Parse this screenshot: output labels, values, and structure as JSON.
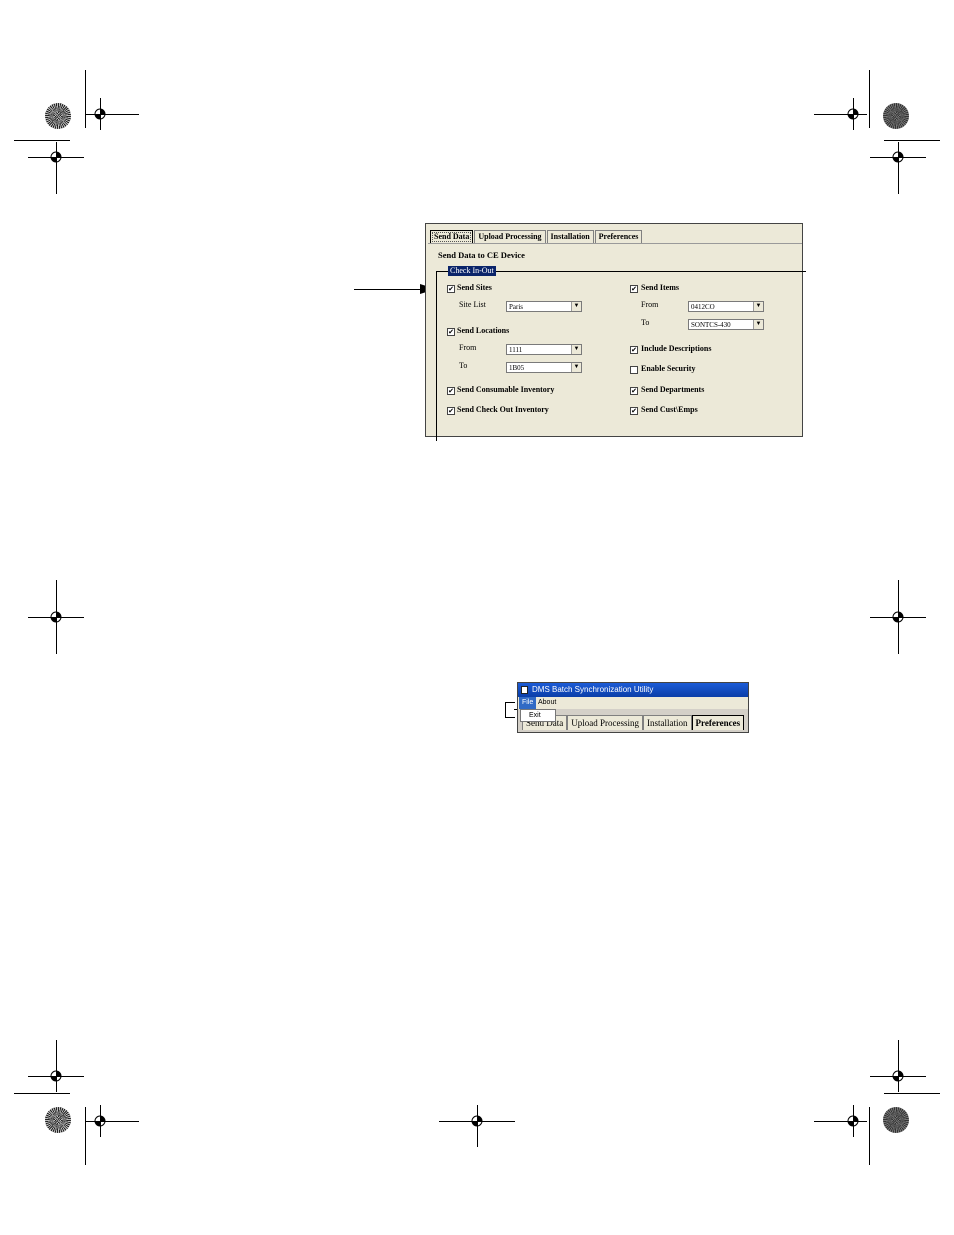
{
  "dialog": {
    "tabs": [
      "Send Data",
      "Upload Processing",
      "Installation",
      "Preferences"
    ],
    "active_tab": "Send Data",
    "panel_title": "Send Data to CE Device",
    "group_label": "Check In-Out",
    "options": {
      "send_sites": {
        "label": "Send Sites",
        "checked": true
      },
      "site_list_label": "Site List",
      "site_list_value": "Paris",
      "send_locations": {
        "label": "Send Locations",
        "checked": true
      },
      "loc_from_label": "From",
      "loc_from_value": "1111",
      "loc_to_label": "To",
      "loc_to_value": "1B05",
      "send_consumable": {
        "label": "Send Consumable Inventory",
        "checked": true
      },
      "send_checkout": {
        "label": "Send Check Out Inventory",
        "checked": true
      },
      "send_items": {
        "label": "Send Items",
        "checked": true
      },
      "items_from_label": "From",
      "items_from_value": "0412CO",
      "items_to_label": "To",
      "items_to_value": "SONTCS-430",
      "include_descriptions": {
        "label": "Include Descriptions",
        "checked": true
      },
      "enable_security": {
        "label": "Enable Security",
        "checked": false
      },
      "send_departments": {
        "label": "Send Departments",
        "checked": true
      },
      "send_cust_emps": {
        "label": "Send Cust\\Emps",
        "checked": true
      }
    },
    "check_mark": "✔"
  },
  "app_window": {
    "title": "DMS Batch Synchronization Utility",
    "menu": [
      "File",
      "About"
    ],
    "file_menu_items": [
      "Exit"
    ],
    "tabs": [
      "Send Data",
      "Upload Processing",
      "Installation",
      "Preferences"
    ]
  }
}
